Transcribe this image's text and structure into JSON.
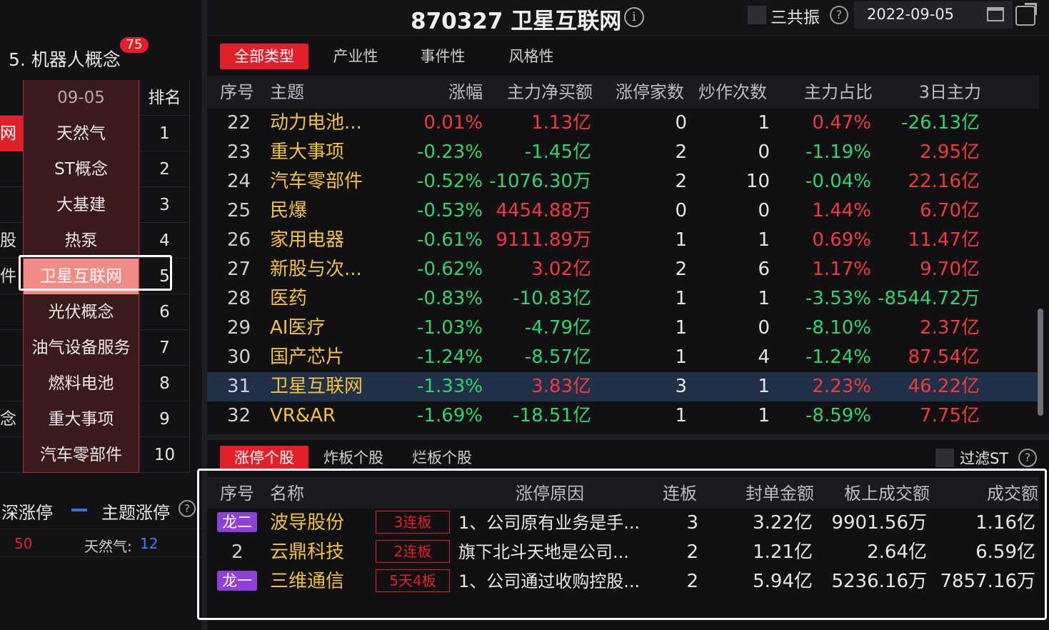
{
  "left": {
    "title": "5. 机器人概念",
    "badge": "75",
    "header": {
      "date": "09-05",
      "rank_label": "排名"
    },
    "rows": [
      {
        "cut": "网",
        "name": "天然气",
        "rank": "1",
        "cut_red": true
      },
      {
        "cut": "",
        "name": "ST概念",
        "rank": "2"
      },
      {
        "cut": "",
        "name": "大基建",
        "rank": "3"
      },
      {
        "cut": "股",
        "name": "热泵",
        "rank": "4"
      },
      {
        "cut": "件",
        "name": "卫星互联网",
        "rank": "5",
        "selected": true
      },
      {
        "cut": "",
        "name": "光伏概念",
        "rank": "6"
      },
      {
        "cut": "",
        "name": "油气设备服务",
        "rank": "7"
      },
      {
        "cut": "",
        "name": "燃料电池",
        "rank": "8"
      },
      {
        "cut": "念",
        "name": "重大事项",
        "rank": "9"
      },
      {
        "cut": "",
        "name": "汽车零部件",
        "rank": "10"
      }
    ],
    "legend": {
      "a": "深涨停",
      "b": "主题涨停",
      "help": "?"
    },
    "footer": {
      "num": "50",
      "label": "天然气:",
      "value": "12"
    }
  },
  "header": {
    "title": "870327 卫星互联网",
    "info": "i",
    "checkbox_label": "三共振",
    "help": "?",
    "date": "2022-09-05"
  },
  "tabs": [
    "全部类型",
    "产业性",
    "事件性",
    "风格性"
  ],
  "themes": {
    "columns": [
      "序号",
      "主题",
      "涨幅",
      "主力净买额",
      "涨停家数",
      "炒作次数",
      "主力占比",
      "3日主力"
    ],
    "rows": [
      {
        "no": "22",
        "name": "动力电池...",
        "chg": "0.01%",
        "net": "1.13亿",
        "limit": "0",
        "times": "1",
        "ratio": "0.47%",
        "d3": "-26.13亿"
      },
      {
        "no": "23",
        "name": "重大事项",
        "chg": "-0.23%",
        "net": "-1.45亿",
        "limit": "2",
        "times": "0",
        "ratio": "-1.19%",
        "d3": "2.95亿"
      },
      {
        "no": "24",
        "name": "汽车零部件",
        "chg": "-0.52%",
        "net": "-1076.30万",
        "limit": "2",
        "times": "10",
        "ratio": "-0.04%",
        "d3": "22.16亿"
      },
      {
        "no": "25",
        "name": "民爆",
        "chg": "-0.53%",
        "net": "4454.88万",
        "limit": "0",
        "times": "0",
        "ratio": "1.44%",
        "d3": "6.70亿"
      },
      {
        "no": "26",
        "name": "家用电器",
        "chg": "-0.61%",
        "net": "9111.89万",
        "limit": "1",
        "times": "1",
        "ratio": "0.69%",
        "d3": "11.47亿"
      },
      {
        "no": "27",
        "name": "新股与次...",
        "chg": "-0.62%",
        "net": "3.02亿",
        "limit": "2",
        "times": "6",
        "ratio": "1.17%",
        "d3": "9.70亿"
      },
      {
        "no": "28",
        "name": "医药",
        "chg": "-0.83%",
        "net": "-10.83亿",
        "limit": "1",
        "times": "1",
        "ratio": "-3.53%",
        "d3": "-8544.72万"
      },
      {
        "no": "29",
        "name": "AI医疗",
        "chg": "-1.03%",
        "net": "-4.79亿",
        "limit": "1",
        "times": "0",
        "ratio": "-8.10%",
        "d3": "2.37亿"
      },
      {
        "no": "30",
        "name": "国产芯片",
        "chg": "-1.24%",
        "net": "-8.57亿",
        "limit": "1",
        "times": "4",
        "ratio": "-1.24%",
        "d3": "87.54亿"
      },
      {
        "no": "31",
        "name": "卫星互联网",
        "chg": "-1.33%",
        "net": "3.83亿",
        "limit": "3",
        "times": "1",
        "ratio": "2.23%",
        "d3": "46.22亿",
        "selected": true
      },
      {
        "no": "32",
        "name": "VR&AR",
        "chg": "-1.69%",
        "net": "-18.51亿",
        "limit": "1",
        "times": "1",
        "ratio": "-8.59%",
        "d3": "7.75亿"
      }
    ]
  },
  "tabs2": [
    "涨停个股",
    "炸板个股",
    "烂板个股"
  ],
  "filter": {
    "label": "过滤ST",
    "help": "?"
  },
  "stocks": {
    "columns": [
      "序号",
      "名称",
      "涨停原因",
      "连板",
      "封单金额",
      "板上成交额",
      "成交额"
    ],
    "rows": [
      {
        "no": "龙二",
        "dragon": true,
        "name": "波导股份",
        "tag": "3连板",
        "reason": "1、公司原有业务是手...",
        "boards": "3",
        "seal": "3.22亿",
        "onboard": "9901.56万",
        "amount": "1.16亿"
      },
      {
        "no": "2",
        "dragon": false,
        "name": "云鼎科技",
        "tag": "2连板",
        "reason": "旗下北斗天地是公司...",
        "boards": "2",
        "seal": "1.21亿",
        "onboard": "2.64亿",
        "amount": "6.59亿"
      },
      {
        "no": "龙一",
        "dragon": true,
        "name": "三维通信",
        "tag": "5天4板",
        "reason": "1、公司通过收购控股...",
        "boards": "2",
        "seal": "5.94亿",
        "onboard": "5236.16万",
        "amount": "7857.16万"
      }
    ]
  },
  "colors": {
    "up": "#f23a3a",
    "down": "#2fd56a",
    "accent": "#e3202a",
    "theme_text": "#f2c23a",
    "selected_row": "#203048",
    "dragon_tag": "#8e40d8"
  },
  "icons": {
    "info": "info-circle-icon",
    "help": "help-circle-icon",
    "calendar": "calendar-icon",
    "export": "export-icon"
  }
}
